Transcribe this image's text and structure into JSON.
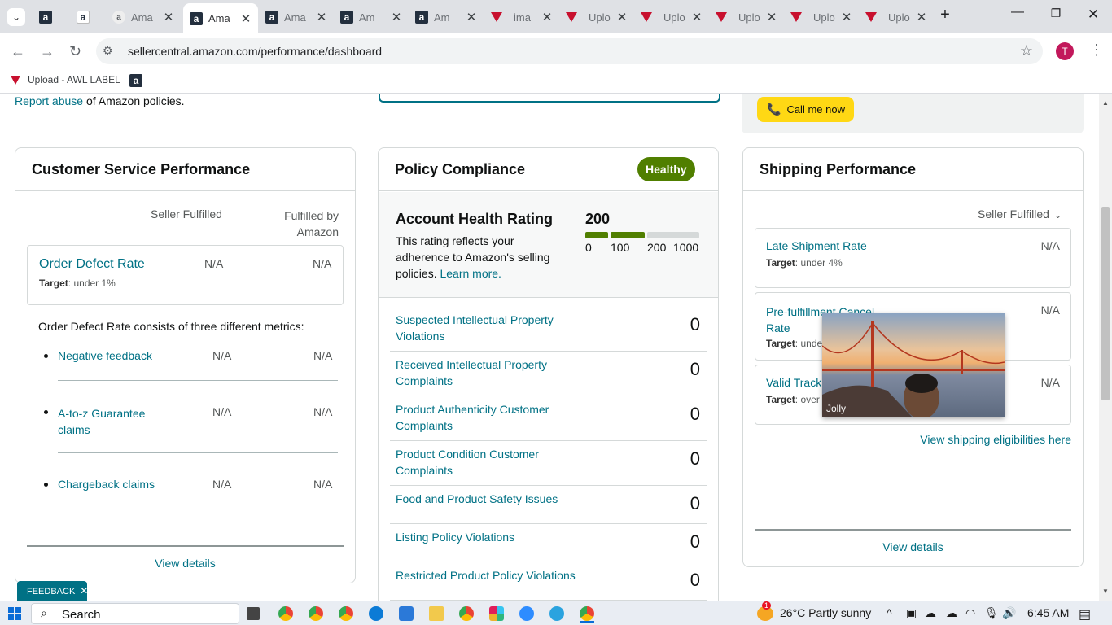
{
  "browser": {
    "tabs": [
      {
        "title": "",
        "icon": "amazon-icon"
      },
      {
        "title": "",
        "icon": "amazon-smile-icon"
      },
      {
        "title": "Ama",
        "icon": "amazon-icon"
      },
      {
        "title": "Ama",
        "icon": "amazon-icon",
        "active": true
      },
      {
        "title": "Ama",
        "icon": "amazon-icon"
      },
      {
        "title": "Am",
        "icon": "amazon-icon"
      },
      {
        "title": "Am",
        "icon": "amazon-icon"
      },
      {
        "title": "ima",
        "icon": "awl-label-icon"
      },
      {
        "title": "Uplo",
        "icon": "awl-label-icon"
      },
      {
        "title": "Uplo",
        "icon": "awl-label-icon"
      },
      {
        "title": "Uplo",
        "icon": "awl-label-icon"
      },
      {
        "title": "Uplo",
        "icon": "awl-label-icon"
      },
      {
        "title": "Uplo",
        "icon": "awl-label-icon"
      }
    ],
    "url": "sellercentral.amazon.com/performance/dashboard",
    "profile_initial": "T",
    "bookmarks": [
      {
        "label": "Upload - AWL LABEL"
      },
      {
        "label": ""
      }
    ]
  },
  "top": {
    "report_abuse_link": "Report abuse",
    "report_abuse_suffix": " of Amazon policies.",
    "call_me_now": "Call me now"
  },
  "customer_service": {
    "title": "Customer Service Performance",
    "col_seller": "Seller Fulfilled",
    "col_fba": "Fulfilled by Amazon",
    "odr_label": "Order Defect Rate",
    "odr_target_label": "Target",
    "odr_target_value": ": under 1%",
    "odr_seller": "N/A",
    "odr_fba": "N/A",
    "intro": "Order Defect Rate consists of three different metrics:",
    "metrics": [
      {
        "label": "Negative feedback",
        "seller": "N/A",
        "fba": "N/A"
      },
      {
        "label": "A-to-z Guarantee claims",
        "seller": "N/A",
        "fba": "N/A"
      },
      {
        "label": "Chargeback claims",
        "seller": "N/A",
        "fba": "N/A"
      }
    ],
    "view_details": "View details"
  },
  "policy_compliance": {
    "title": "Policy Compliance",
    "status_badge": "Healthy",
    "ahr_title": "Account Health Rating",
    "ahr_value": "200",
    "ahr_desc": "This rating reflects your adherence to Amazon's selling policies. ",
    "learn_more": "Learn more.",
    "scale_labels": [
      "0",
      "100",
      "200",
      "1000"
    ],
    "rows": [
      {
        "label": "Suspected Intellectual Property Violations",
        "count": "0"
      },
      {
        "label": "Received Intellectual Property Complaints",
        "count": "0"
      },
      {
        "label": "Product Authenticity Customer Complaints",
        "count": "0"
      },
      {
        "label": "Product Condition Customer Complaints",
        "count": "0"
      },
      {
        "label": "Food and Product Safety Issues",
        "count": "0"
      },
      {
        "label": "Listing Policy Violations",
        "count": "0"
      },
      {
        "label": "Restricted Product Policy Violations",
        "count": "0"
      }
    ],
    "colors": {
      "healthy": "#507f00",
      "bar_empty": "#d5d9d9"
    }
  },
  "shipping": {
    "title": "Shipping Performance",
    "dropdown": "Seller Fulfilled",
    "metrics": [
      {
        "label": "Late Shipment Rate",
        "value": "N/A",
        "target_label": "Target",
        "target_value": ": under 4%"
      },
      {
        "label": "Pre-fulfillment Cancel Rate",
        "value": "N/A",
        "target_label": "Target",
        "target_value": ": unde"
      },
      {
        "label": "Valid Track",
        "value": "N/A",
        "target_label": "Target",
        "target_value": ": over"
      }
    ],
    "eligibilities_link": "View shipping eligibilities here",
    "view_details": "View details"
  },
  "video_overlay": {
    "name": "Jolly"
  },
  "feedback_tab": "FEEDBACK",
  "taskbar": {
    "search": "Search",
    "weather": "26°C  Partly sunny",
    "time": "6:45 AM",
    "weather_badge": "1"
  }
}
